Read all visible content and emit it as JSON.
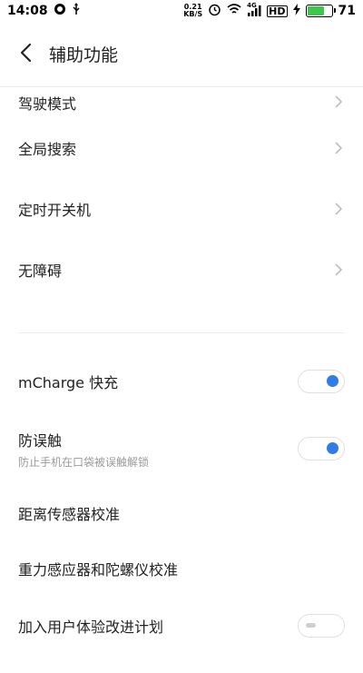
{
  "status_bar": {
    "time": "14:08",
    "speed_value": "0.21",
    "speed_unit": "KB/S",
    "network_label": "4G",
    "hd_label": "HD",
    "battery_level": "71",
    "battery_fraction": 0.71
  },
  "header": {
    "title": "辅助功能"
  },
  "nav_items": [
    {
      "label": "驾驶模式"
    },
    {
      "label": "全局搜索"
    },
    {
      "label": "定时开关机"
    },
    {
      "label": "无障碍"
    }
  ],
  "settings": {
    "mcharge": {
      "label": "mCharge 快充",
      "enabled": true
    },
    "anti_touch": {
      "label": "防误触",
      "sublabel": "防止手机在口袋被误触解锁",
      "enabled": true
    },
    "proximity": {
      "label": "距离传感器校准"
    },
    "gravity": {
      "label": "重力感应器和陀螺仪校准"
    },
    "ux_plan": {
      "label": "加入用户体验改进计划",
      "enabled": false
    }
  },
  "colors": {
    "accent": "#2f7be8",
    "battery": "#3cc84a"
  }
}
